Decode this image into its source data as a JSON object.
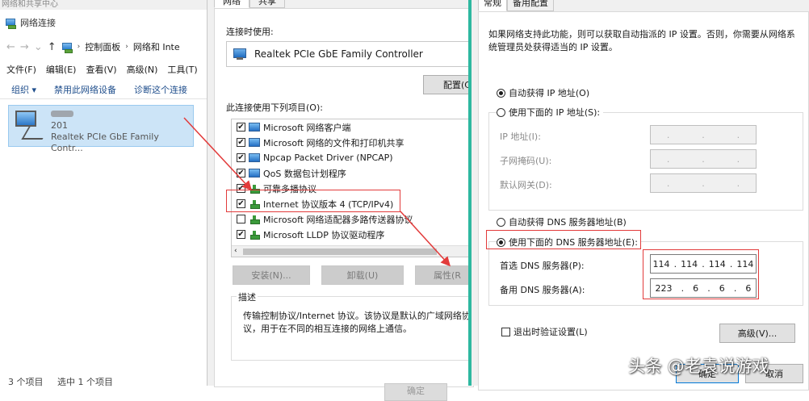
{
  "net_window": {
    "top_title": "网络和共享中心",
    "title": "网络连接",
    "breadcrumb": [
      "控制面板",
      "网络和 Inte"
    ],
    "menu": [
      "文件(F)",
      "编辑(E)",
      "查看(V)",
      "高级(N)",
      "工具(T)"
    ],
    "commands": [
      "组织 ▾",
      "禁用此网络设备",
      "诊断这个连接"
    ],
    "adapter": {
      "line1": "xx",
      "line2": "201",
      "line3": "Realtek PCIe GbE Family Contr..."
    },
    "status": [
      "3 个项目",
      "选中 1 个项目"
    ]
  },
  "prop_window": {
    "tabs": [
      "网络",
      "共享"
    ],
    "connect_using_label": "连接时使用:",
    "adapter_name": "Realtek PCIe GbE Family Controller",
    "configure_button": "配置(C",
    "items_label": "此连接使用下列项目(O):",
    "items": [
      {
        "label": "Microsoft 网络客户端",
        "checked": true,
        "icon": "client-icon"
      },
      {
        "label": "Microsoft 网络的文件和打印机共享",
        "checked": true,
        "icon": "client-icon"
      },
      {
        "label": "Npcap Packet Driver (NPCAP)",
        "checked": true,
        "icon": "client-icon"
      },
      {
        "label": "QoS 数据包计划程序",
        "checked": true,
        "icon": "client-icon"
      },
      {
        "label": "可靠多播协议",
        "checked": true,
        "icon": "protocol-icon"
      },
      {
        "label": "Internet 协议版本 4 (TCP/IPv4)",
        "checked": true,
        "icon": "protocol-icon"
      },
      {
        "label": "Microsoft 网络适配器多路传送器协议",
        "checked": false,
        "icon": "protocol-icon"
      },
      {
        "label": "Microsoft LLDP 协议驱动程序",
        "checked": true,
        "icon": "protocol-icon"
      }
    ],
    "install_button": "安装(N)...",
    "uninstall_button": "卸载(U)",
    "properties_button": "属性(R",
    "description_legend": "描述",
    "description_text": "传输控制协议/Internet 协议。该协议是默认的广域网络协议，用于在不同的相互连接的网络上通信。",
    "ok_button": "确定"
  },
  "ipv4_window": {
    "tabs": [
      "常规",
      "备用配置"
    ],
    "intro": "如果网络支持此功能，则可以获取自动指派的 IP 设置。否则，你需要从网络系统管理员处获得适当的 IP 设置。",
    "auto_ip": "自动获得 IP 地址(O)",
    "manual_ip": "使用下面的 IP 地址(S):",
    "ip_address_label": "IP 地址(I):",
    "subnet_label": "子网掩码(U):",
    "gateway_label": "默认网关(D):",
    "auto_dns": "自动获得 DNS 服务器地址(B)",
    "manual_dns": "使用下面的 DNS 服务器地址(E):",
    "preferred_dns_label": "首选 DNS 服务器(P):",
    "alternate_dns_label": "备用 DNS 服务器(A):",
    "preferred_dns": [
      "114",
      "114",
      "114",
      "114"
    ],
    "alternate_dns": [
      "223",
      "6",
      "6",
      "6"
    ],
    "validate_on_exit": "退出时验证设置(L)",
    "advanced_button": "高级(V)...",
    "ok_button": "确定",
    "cancel_button": "取消"
  },
  "watermark": "头条 @老袁说游戏",
  "colors": {
    "annotation_red": "#e23b3b",
    "selection_blue": "#cce4f7",
    "window_accent": "#2eb8a0"
  }
}
